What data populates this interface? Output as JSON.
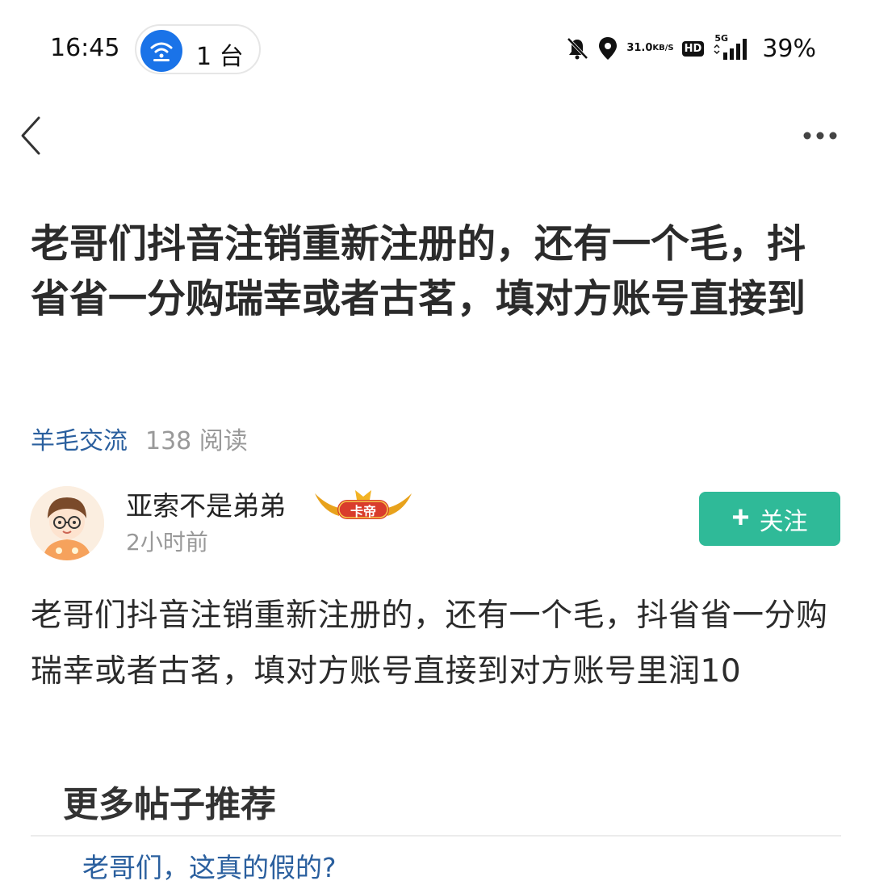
{
  "status_bar": {
    "time": "16:45",
    "hotspot_count": "1 台",
    "net_speed_value": "31.0",
    "net_speed_unit": "KB/S",
    "hd_label": "HD",
    "network_label": "5G",
    "battery": "39%",
    "icons": [
      "hotspot-icon",
      "bell-muted-icon",
      "location-icon",
      "signal-icon"
    ]
  },
  "nav": {
    "back_icon": "chevron-left-icon",
    "more_icon": "more-dots-icon"
  },
  "post": {
    "title": "老哥们抖音注销重新注册的，还有一个毛，抖省省一分购瑞幸或者古茗，填对方账号直接到",
    "category": "羊毛交流",
    "read_count": "138 阅读",
    "author": {
      "name": "亚索不是弟弟",
      "badge": "卡帝",
      "time": "2小时前"
    },
    "follow_label": "关注",
    "follow_icon": "plus-icon",
    "body": "老哥们抖音注销重新注册的，还有一个毛，抖省省一分购瑞幸或者古茗，填对方账号直接到对方账号里润10"
  },
  "recommend": {
    "heading": "更多帖子推荐",
    "items": [
      {
        "title": "老哥们，这真的假的?"
      }
    ]
  },
  "colors": {
    "accent_green": "#2fba98",
    "link_blue": "#2a5f9e",
    "hotspot_blue": "#1a73e8"
  }
}
